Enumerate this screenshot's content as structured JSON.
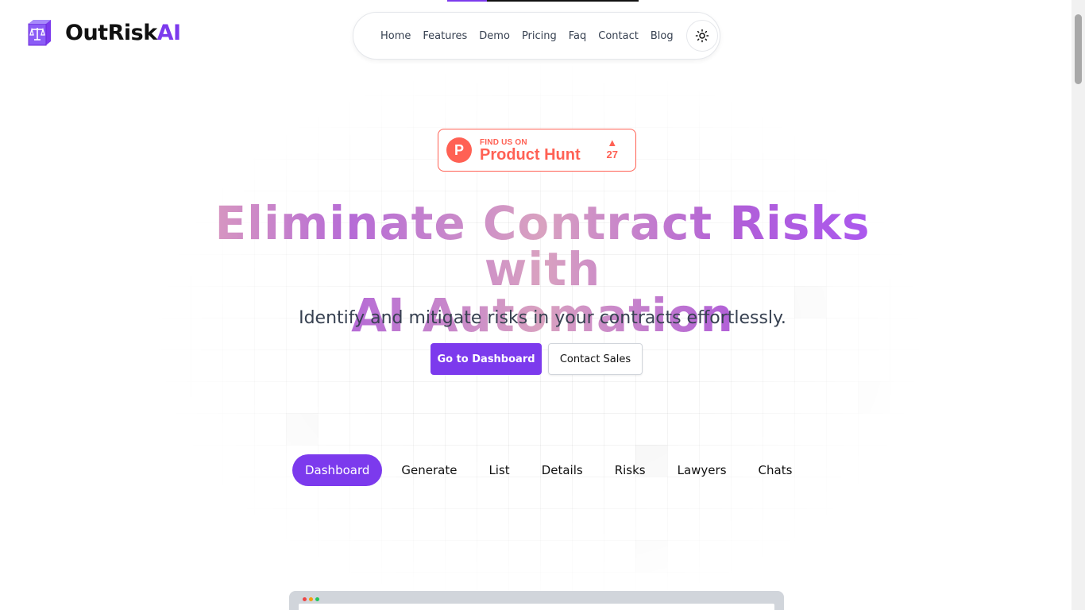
{
  "brand": {
    "name_main": "OutRisk",
    "name_accent": "AI",
    "accent_color": "#7c3aed"
  },
  "nav": {
    "items": [
      {
        "label": "Home"
      },
      {
        "label": "Features"
      },
      {
        "label": "Demo"
      },
      {
        "label": "Pricing"
      },
      {
        "label": "Faq"
      },
      {
        "label": "Contact"
      },
      {
        "label": "Blog"
      }
    ],
    "theme_toggle_icon": "sun-icon"
  },
  "product_hunt": {
    "small_text": "FIND US ON",
    "big_text": "Product Hunt",
    "logo_letter": "P",
    "upvotes": "27",
    "color": "#ff6154"
  },
  "hero": {
    "title_line1": "Eliminate Contract Risks with",
    "title_line2": "AI Automation",
    "subtitle": "Identify and mitigate risks in your contracts effortlessly.",
    "primary_button": "Go to Dashboard",
    "secondary_button": "Contact Sales"
  },
  "tabs": [
    {
      "label": "Dashboard",
      "active": true
    },
    {
      "label": "Generate",
      "active": false
    },
    {
      "label": "List",
      "active": false
    },
    {
      "label": "Details",
      "active": false
    },
    {
      "label": "Risks",
      "active": false
    },
    {
      "label": "Lawyers",
      "active": false
    },
    {
      "label": "Chats",
      "active": false
    }
  ]
}
